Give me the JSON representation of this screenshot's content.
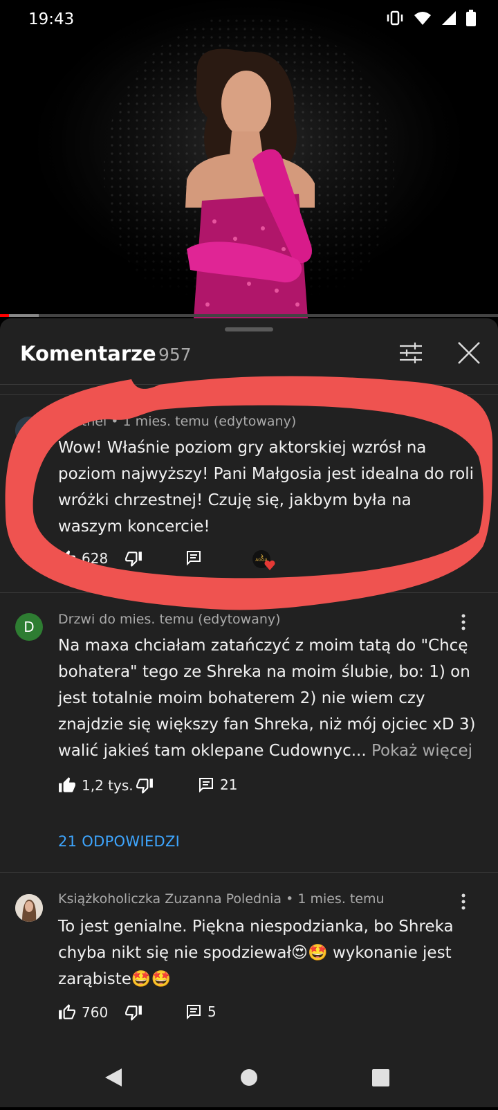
{
  "status_bar": {
    "time": "19:43"
  },
  "video": {
    "progress_fraction": 0.06,
    "buffer_fraction": 0.06
  },
  "comments_panel": {
    "title": "Komentarze",
    "count": "957",
    "comments": [
      {
        "author": "Grethel",
        "meta": "Grethel • 1 mies. temu (edytowany)",
        "text": "Wow! Właśnie poziom gry aktorskiej wzrósł na poziom najwyższy! Pani Małgosia jest idealna do roli wróżki chrzestnej! Czuję się, jakbym była na waszym koncercie!",
        "likes": "628",
        "creator_heart_label": "AGGA"
      },
      {
        "author_initial": "D",
        "meta_visible": "Drzwi do                            mies. temu (edytowany)",
        "text_main": "Na maxa chciałam zatańczyć z moim tatą do \"Chcę bohatera\" tego ze Shreka na moim ślubie, bo: 1) on jest totalnie moim bohaterem 2) nie wiem czy znajdzie się większy fan Shreka, niż mój ojciec xD 3) walić jakieś tam oklepane Cudownyc...",
        "show_more": "Pokaż więcej",
        "likes": "1,2 tys.",
        "reply_count": "21",
        "replies_link": "21 ODPOWIEDZI"
      },
      {
        "author": "Książkoholiczka Zuzanna Polednia",
        "meta": "Książkoholiczka Zuzanna Polednia • 1 mies. temu",
        "text": "To jest genialne. Piękna niespodzianka, bo Shreka chyba nikt się nie spodziewał😍🤩 wykonanie jest zarąbiste🤩🤩",
        "likes": "760",
        "reply_count": "5"
      }
    ]
  },
  "colors": {
    "panel_bg": "#212121",
    "accent_blue": "#3ea6ff",
    "highlight_marker": "#ef5350",
    "dress_pink": "#d81b8a"
  }
}
